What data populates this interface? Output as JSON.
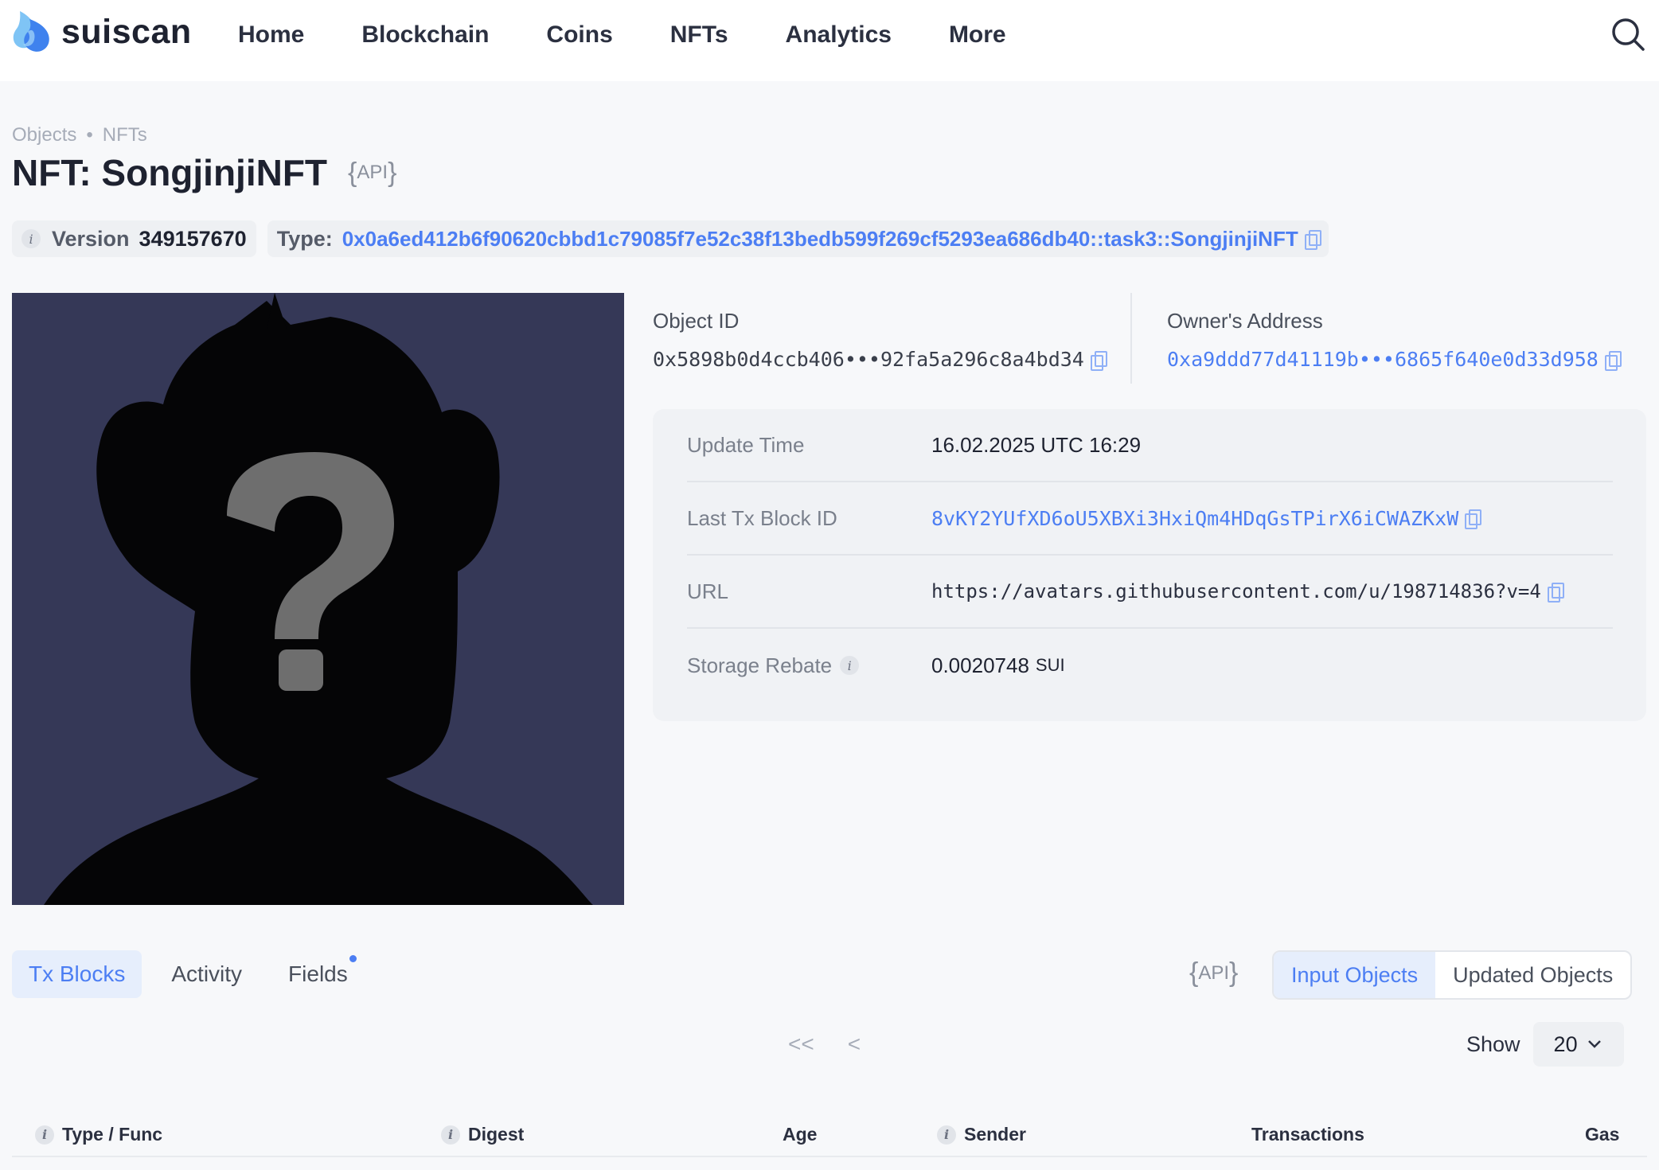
{
  "brand": {
    "name": "suiscan"
  },
  "nav": {
    "items": [
      "Home",
      "Blockchain",
      "Coins",
      "NFTs",
      "Analytics",
      "More"
    ]
  },
  "breadcrumb": {
    "items": [
      "Objects",
      "NFTs"
    ]
  },
  "page": {
    "title": "NFT: SongjinjiNFT",
    "api_label": "API"
  },
  "chips": {
    "version_label": "Version",
    "version_value": "349157670",
    "type_label": "Type:",
    "type_value": "0x0a6ed412b6f90620cbbd1c79085f7e52c38f13bedb599f269cf5293ea686db40::task3::SongjinjiNFT"
  },
  "object": {
    "id_label": "Object ID",
    "id_value": "0x5898b0d4ccb406•••92fa5a296c8a4bd34"
  },
  "owner": {
    "label": "Owner's Address",
    "value": "0xa9ddd77d41119b•••6865f640e0d33d958"
  },
  "details": {
    "update_time_label": "Update Time",
    "update_time_value": "16.02.2025 UTC 16:29",
    "last_tx_label": "Last Tx Block ID",
    "last_tx_value": "8vKY2YUfXD6oU5XBXi3HxiQm4HDqGsTPirX6iCWAZKxW",
    "url_label": "URL",
    "url_value": "https://avatars.githubusercontent.com/u/198714836?v=4",
    "storage_rebate_label": "Storage Rebate",
    "storage_rebate_value": "0.0020748",
    "storage_rebate_unit": "SUI"
  },
  "tabs": {
    "items": [
      "Tx Blocks",
      "Activity",
      "Fields"
    ],
    "active": "Tx Blocks"
  },
  "tabs_api_label": "API",
  "segment": {
    "items": [
      "Input Objects",
      "Updated Objects"
    ],
    "active": "Input Objects"
  },
  "pager": {
    "first": "<<",
    "prev": "<"
  },
  "show": {
    "label": "Show",
    "value": "20"
  },
  "table": {
    "headers": [
      "Type / Func",
      "Digest",
      "Age",
      "Sender",
      "Transactions",
      "Gas"
    ]
  },
  "colors": {
    "accent": "#4c7ef3",
    "background": "#f7f8fa",
    "nft_bg": "#353857"
  },
  "icons": [
    "logo-droplet-icon",
    "search-icon",
    "info-icon",
    "copy-icon",
    "chevron-down-icon"
  ]
}
